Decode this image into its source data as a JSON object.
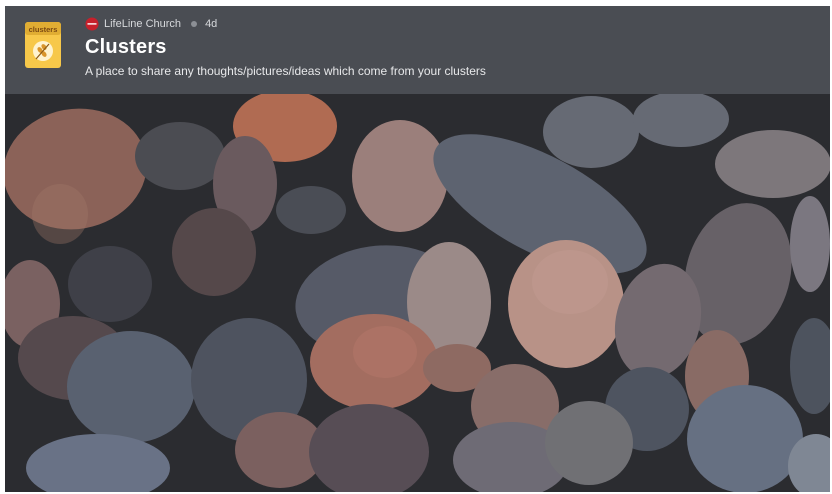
{
  "group": {
    "organization": "LifeLine Church",
    "age": "4d",
    "title": "Clusters",
    "description": "A place to share any thoughts/pictures/ideas which come from your clusters",
    "app_icon_text": "clusters"
  },
  "icons": {
    "app": "clusters-app-icon",
    "church": "church-logo-icon",
    "separator": "dot-separator-icon"
  },
  "colors": {
    "header_bg": "#4a4d53",
    "icon_yellow": "#f7c84a",
    "church_red": "#c7202b"
  },
  "cover_image": {
    "subject": "pebbles"
  }
}
